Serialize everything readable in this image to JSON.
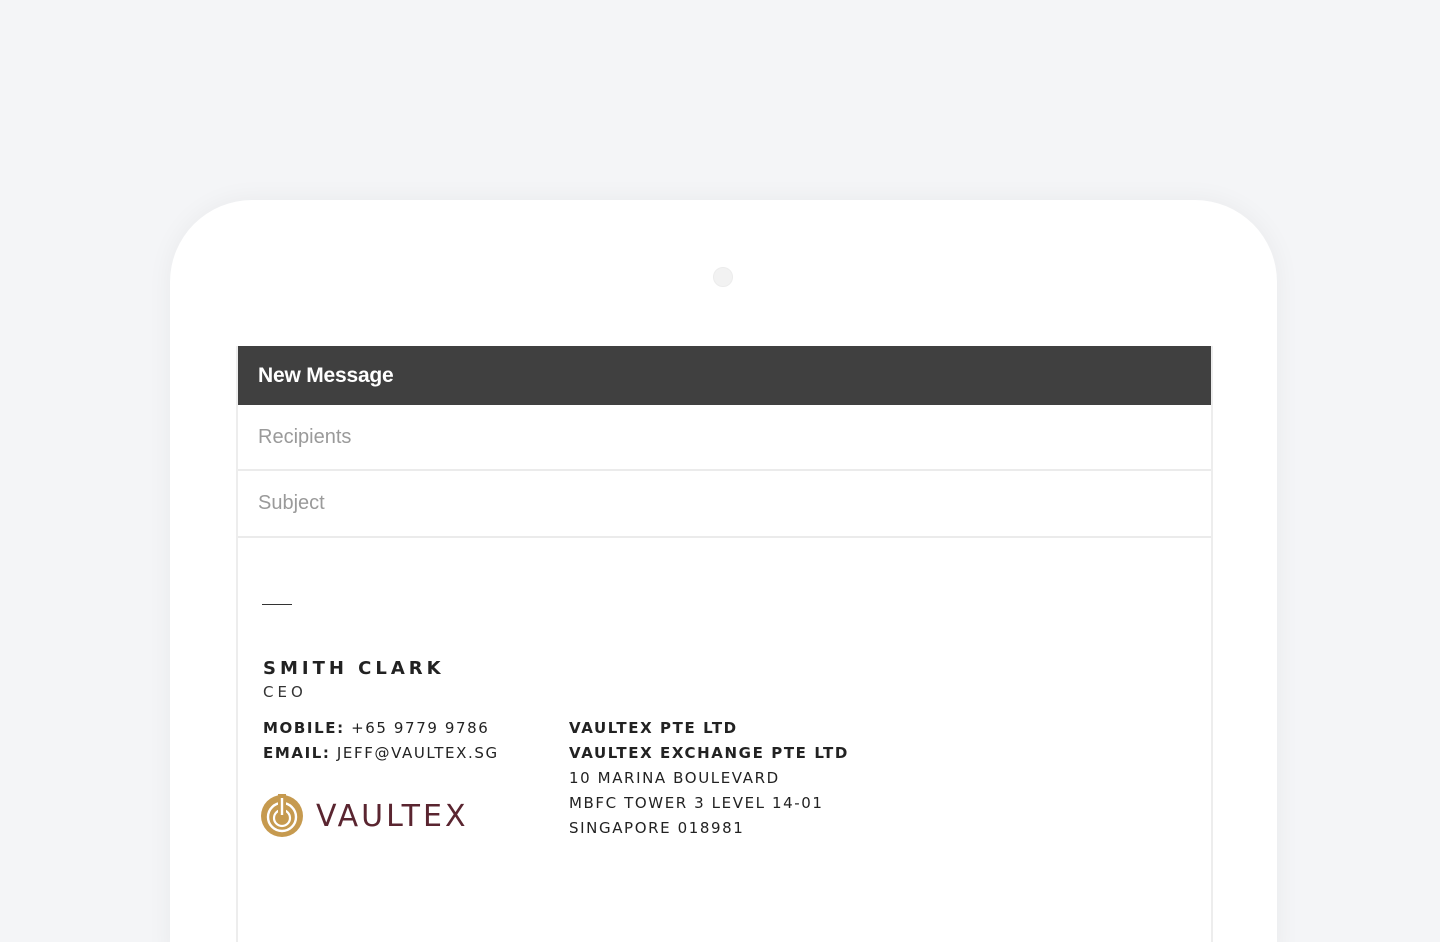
{
  "composer": {
    "title": "New Message",
    "recipients_placeholder": "Recipients",
    "recipients_value": "",
    "subject_placeholder": "Subject",
    "subject_value": ""
  },
  "signature": {
    "name": "SMITH CLARK",
    "title": "CEO",
    "mobile_label": "MOBILE:",
    "mobile_value": "+65 9779 9786",
    "email_label": "EMAIL:",
    "email_value": "JEFF@VAULTEX.SG",
    "company_lines": [
      "VAULTEX PTE LTD",
      "VAULTEX EXCHANGE PTE LTD"
    ],
    "address_lines": [
      "10 MARINA BOULEVARD",
      "MBFC TOWER 3 LEVEL 14-01",
      "SINGAPORE 018981"
    ],
    "logo_text": "VAULTEX"
  },
  "colors": {
    "background": "#f4f5f7",
    "header": "#404040",
    "logo_gold": "#c69a4f",
    "logo_wordmark": "#5a2530"
  }
}
